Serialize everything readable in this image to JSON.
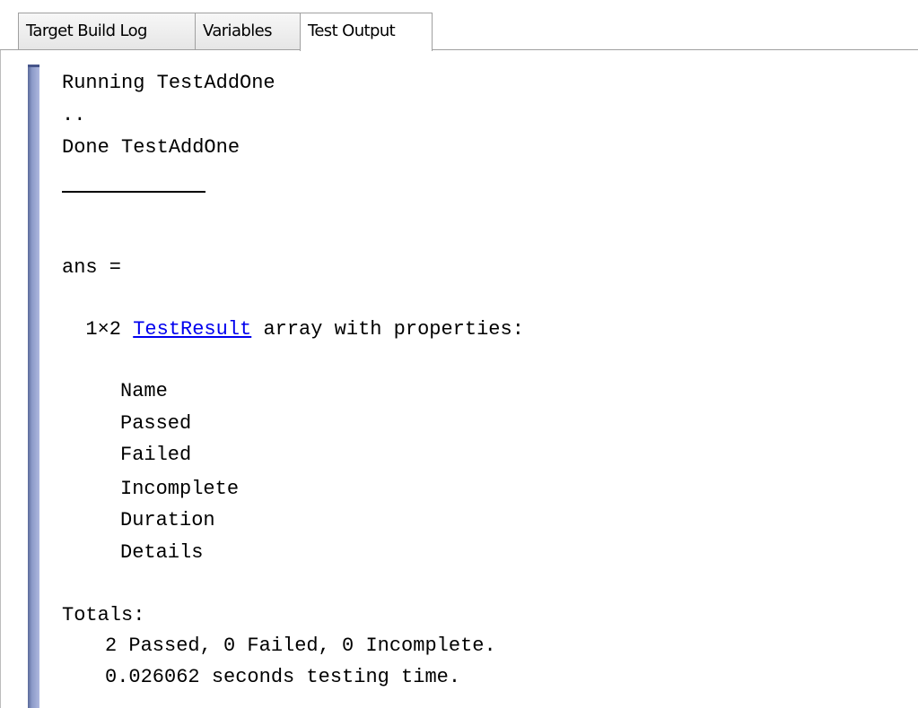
{
  "tabs": [
    {
      "label": "Target Build Log",
      "active": false
    },
    {
      "label": "Variables",
      "active": false
    },
    {
      "label": "Test Output",
      "active": true
    }
  ],
  "console": {
    "running": "Running TestAddOne",
    "progress": "..",
    "done": "Done TestAddOne",
    "ans": "ans =",
    "array_prefix": "  1×2 ",
    "array_link": "TestResult",
    "array_suffix": " array with properties:",
    "properties": [
      "Name",
      "Passed",
      "Failed",
      "Incomplete",
      "Duration",
      "Details"
    ],
    "totals_header": "Totals:",
    "totals_summary": "2 Passed, 0 Failed, 0 Incomplete.",
    "totals_time": "0.026062 seconds testing time."
  },
  "colors": {
    "link": "#0000ee",
    "gutter": "#8c9ac8"
  }
}
